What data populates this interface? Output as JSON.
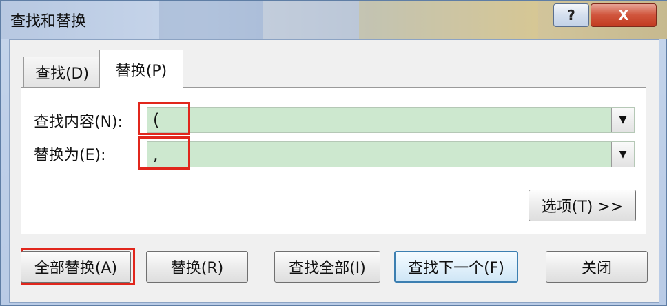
{
  "window": {
    "title": "查找和替换",
    "help_label": "?",
    "close_label": "X"
  },
  "tabs": [
    {
      "label": "查找(D)",
      "active": false
    },
    {
      "label": "替换(P)",
      "active": true
    }
  ],
  "fields": {
    "find_label": "查找内容(N):",
    "find_value": "(",
    "replace_label": "替换为(E):",
    "replace_value": ","
  },
  "buttons": {
    "options": "选项(T) >>",
    "replace_all": "全部替换(A)",
    "replace": "替换(R)",
    "find_all": "查找全部(I)",
    "find_next": "查找下一个(F)",
    "close": "关闭"
  },
  "icons": {
    "dropdown": "▼"
  },
  "colors": {
    "highlight": "#e1261c",
    "input_fill": "#cde8cf",
    "default_button_border": "#3c7fb1"
  }
}
